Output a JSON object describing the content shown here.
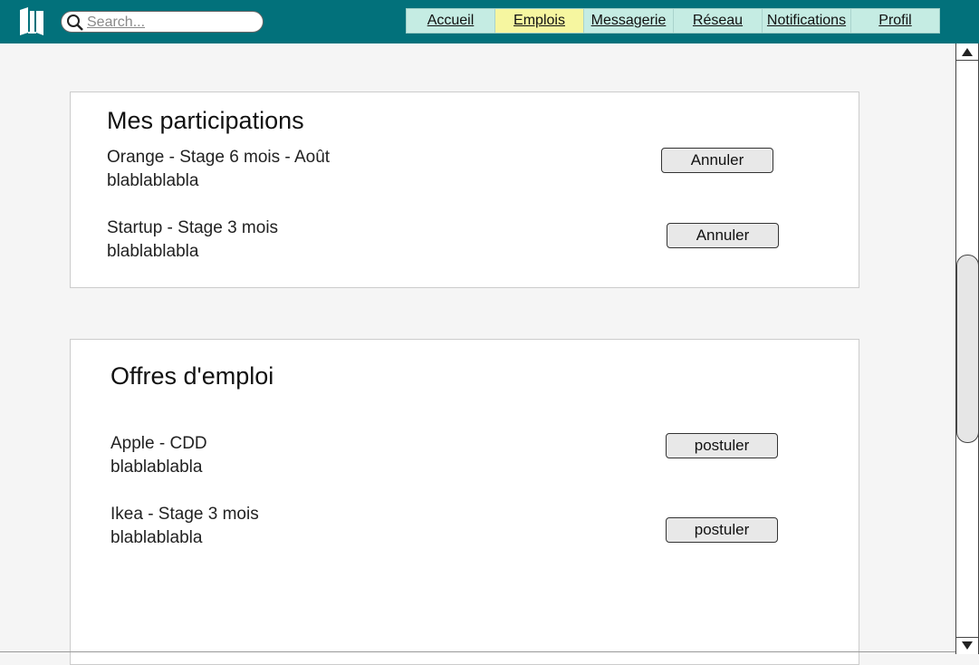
{
  "header": {
    "search_placeholder": "Search...",
    "tabs": [
      {
        "label": "Accueil",
        "active": false
      },
      {
        "label": "Emplois",
        "active": true
      },
      {
        "label": "Messagerie",
        "active": false
      },
      {
        "label": "Réseau",
        "active": false
      },
      {
        "label": "Notifications",
        "active": false
      },
      {
        "label": "Profil",
        "active": false
      }
    ],
    "colors": {
      "bar": "#02717b",
      "tab": "#c5ece3",
      "active_tab": "#f6f6a0"
    }
  },
  "participations": {
    "title": "Mes participations",
    "items": [
      {
        "title": "Orange - Stage 6 mois - Août",
        "desc": "blablablabla",
        "action": "Annuler"
      },
      {
        "title": "Startup - Stage 3 mois",
        "desc": "blablablabla",
        "action": "Annuler"
      }
    ]
  },
  "offres": {
    "title": "Offres d'emploi",
    "items": [
      {
        "title": "Apple - CDD",
        "desc": "blablablabla",
        "action": "postuler"
      },
      {
        "title": "Ikea - Stage 3 mois",
        "desc": "blablablabla",
        "action": "postuler"
      }
    ]
  },
  "icons": {
    "logo": "book-logo-icon",
    "search": "search-icon",
    "scroll_up": "arrow-up-icon",
    "scroll_down": "arrow-down-icon"
  }
}
